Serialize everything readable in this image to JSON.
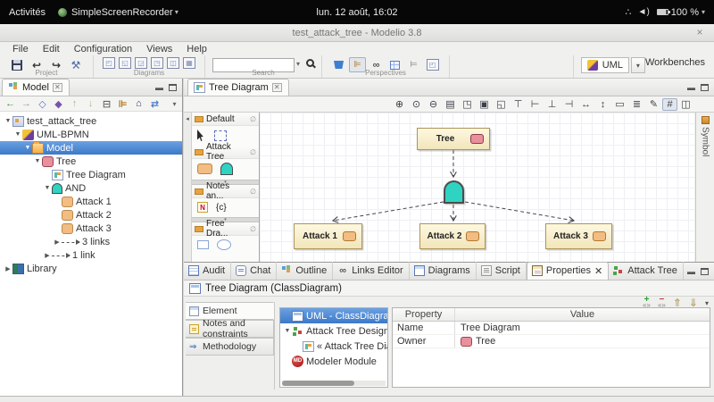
{
  "desktop": {
    "activities": "Activités",
    "app_name": "SimpleScreenRecorder",
    "clock": "lun. 12 août, 16:02",
    "battery_pct": "100 %"
  },
  "window": {
    "title": "test_attack_tree - Modelio 3.8",
    "close_glyph": "×"
  },
  "menu": {
    "items": [
      "File",
      "Edit",
      "Configuration",
      "Views",
      "Help"
    ]
  },
  "toolbar": {
    "group_labels": {
      "project": "Project",
      "diagrams": "Diagrams",
      "search": "Search",
      "perspectives": "Perspectives",
      "workbenches": "Workbenches"
    },
    "workbench_value": "UML",
    "search_value": "",
    "diagram_buttons": [
      "class-diagram",
      "package-diagram",
      "use-case-diagram",
      "composite-diagram",
      "activity-diagram",
      "matrix-new"
    ],
    "perspective_buttons": [
      {
        "name": "paint-bucket",
        "pressed": false
      },
      {
        "name": "outline-view",
        "pressed": true
      },
      {
        "name": "links-view",
        "pressed": false
      },
      {
        "name": "table-view",
        "pressed": false
      },
      {
        "name": "tree-check-view",
        "pressed": false
      },
      {
        "name": "window-view",
        "pressed": false
      }
    ]
  },
  "model_panel": {
    "tab": "Model",
    "toolbar_icons": [
      "nav-back",
      "nav-forward",
      "related-diagram",
      "related-element",
      "move-up",
      "move-down",
      "collapse-all",
      "link-with-editor",
      "home",
      "sync-with-tree",
      "view-menu"
    ],
    "rows": [
      {
        "label": "test_attack_tree",
        "indent": 0,
        "exp": "open",
        "icon": "project"
      },
      {
        "label": "UML-BPMN",
        "indent": 1,
        "exp": "open",
        "icon": "uml"
      },
      {
        "label": "Model",
        "indent": 2,
        "exp": "open",
        "icon": "folder",
        "selected": true
      },
      {
        "label": "Tree",
        "indent": 3,
        "exp": "open",
        "icon": "class-pink"
      },
      {
        "label": "Tree Diagram",
        "indent": 4,
        "exp": "none",
        "icon": "diagram"
      },
      {
        "label": "AND",
        "indent": 4,
        "exp": "open",
        "icon": "and"
      },
      {
        "label": "Attack 1",
        "indent": 5,
        "exp": "none",
        "icon": "class-orange"
      },
      {
        "label": "Attack 2",
        "indent": 5,
        "exp": "none",
        "icon": "class-orange"
      },
      {
        "label": "Attack 3",
        "indent": 5,
        "exp": "none",
        "icon": "class-orange"
      },
      {
        "label": "3 links",
        "indent": 5,
        "exp": "closed",
        "icon": "linkarrow"
      },
      {
        "label": "1 link",
        "indent": 4,
        "exp": "closed",
        "icon": "linkarrow"
      },
      {
        "label": "Library",
        "indent": 0,
        "exp": "closed",
        "icon": "library"
      }
    ]
  },
  "editor": {
    "tab": "Tree Diagram",
    "symbol_tab": "Symbol",
    "collapse_glyph": "◂",
    "toolbar_icons": [
      {
        "name": "zoom-in",
        "g": "⊕"
      },
      {
        "name": "zoom-actual",
        "g": "⊙"
      },
      {
        "name": "zoom-out",
        "g": "⊖"
      },
      {
        "name": "print",
        "g": "▤"
      },
      {
        "name": "save-image",
        "g": "◳"
      },
      {
        "name": "screenshot",
        "g": "▣"
      },
      {
        "name": "zoom-selection",
        "g": "◱"
      },
      {
        "name": "align-top",
        "g": "⊤"
      },
      {
        "name": "align-left",
        "g": "⊢"
      },
      {
        "name": "align-bottom",
        "g": "⊥"
      },
      {
        "name": "align-right",
        "g": "⊣"
      },
      {
        "name": "same-width",
        "g": "↔"
      },
      {
        "name": "same-height",
        "g": "↕"
      },
      {
        "name": "same-size",
        "g": "▭"
      },
      {
        "name": "distribute",
        "g": "≣"
      },
      {
        "name": "format-paint",
        "g": "✎"
      },
      {
        "name": "grid",
        "g": "#",
        "pressed": true
      },
      {
        "name": "page-setup",
        "g": "◫"
      }
    ],
    "palette": {
      "sections": [
        {
          "label": "Default",
          "pin": "∅",
          "items": [
            "cursor",
            "marquee"
          ],
          "overflow": false
        },
        {
          "label": "Attack Tree",
          "pin": "∅",
          "items": [
            "attack",
            "and"
          ],
          "overflow": true
        },
        {
          "label": "Notes an...",
          "pin": "∅",
          "items": [
            "note",
            "constraint"
          ],
          "overflow": true
        },
        {
          "label": "Free Dra...",
          "pin": "∅",
          "items": [
            "rect",
            "ellipse"
          ],
          "overflow": false
        }
      ],
      "note_glyph": "N",
      "constraint_glyph": "{c}"
    },
    "canvas": {
      "tree_label": "Tree",
      "attack_labels": [
        "Attack 1",
        "Attack 2",
        "Attack 3"
      ]
    }
  },
  "bottom_panel": {
    "tabs": [
      {
        "label": "Audit",
        "icon": "audit"
      },
      {
        "label": "Chat",
        "icon": "chat"
      },
      {
        "label": "Outline",
        "icon": "outline"
      },
      {
        "label": "Links Editor",
        "icon": "links"
      },
      {
        "label": "Diagrams",
        "icon": "diagrams"
      },
      {
        "label": "Script",
        "icon": "script"
      },
      {
        "label": "Properties",
        "icon": "properties",
        "active": true
      },
      {
        "label": "Attack Tree",
        "icon": "attacktree"
      }
    ],
    "header": "Tree Diagram (ClassDiagram)",
    "side_tabs": [
      {
        "label": "Element",
        "icon": "element",
        "selected": true
      },
      {
        "label": "Notes and constraints",
        "icon": "notes"
      },
      {
        "label": "Methodology",
        "icon": "methodology"
      }
    ],
    "module_tree": [
      {
        "label": "UML - ClassDiagram",
        "icon": "diagram2",
        "indent": 0,
        "exp": "none",
        "selected": true
      },
      {
        "label": "Attack Tree Designer",
        "icon": "attacktree",
        "indent": 0,
        "exp": "open"
      },
      {
        "label": "« Attack Tree Diagram »",
        "icon": "diagramsm",
        "indent": 1,
        "exp": "none"
      },
      {
        "label": "Modeler Module",
        "icon": "module",
        "indent": 0,
        "exp": "none"
      }
    ],
    "module_badge": "MD",
    "table": {
      "headers": [
        "Property",
        "Value"
      ],
      "rows": [
        {
          "property": "Name",
          "value": "Tree Diagram",
          "icon": null
        },
        {
          "property": "Owner",
          "value": "Tree",
          "icon": "class-pink"
        }
      ]
    },
    "action_icons": [
      "add-stereotype",
      "remove-stereotype",
      "move-up",
      "move-down",
      "menu"
    ]
  },
  "colors": {
    "selection_blue": "#3c79c8",
    "node_fill": "#f8eecb",
    "node_border": "#ac9458",
    "and_teal": "#2fd3c2",
    "class_pink": "#e8909c",
    "class_orange": "#f2bc82"
  }
}
